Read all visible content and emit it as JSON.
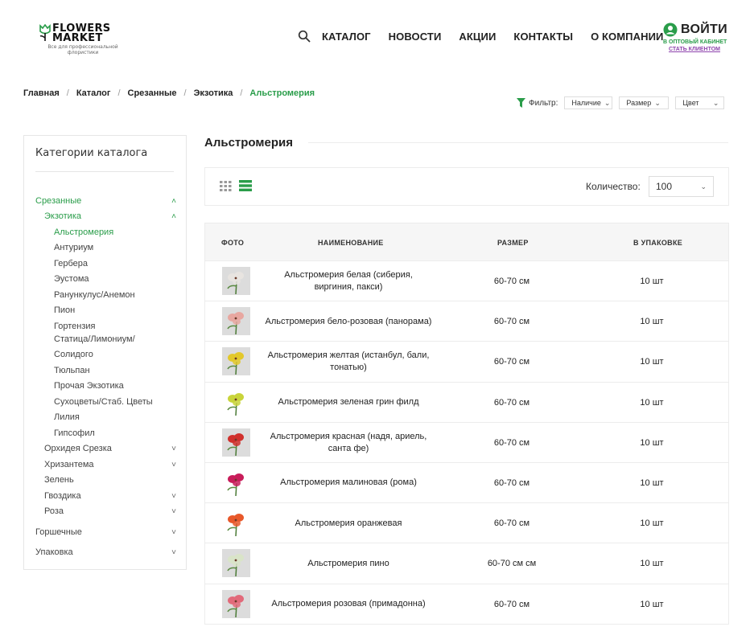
{
  "header": {
    "logo_title_1": "FLOWERS",
    "logo_title_2": "MARKET",
    "logo_subtitle": "Все для профессиональной флористики",
    "nav": [
      "КАТАЛОГ",
      "НОВОСТИ",
      "АКЦИИ",
      "КОНТАКТЫ",
      "О КОМПАНИИ"
    ],
    "login_label": "ВОЙТИ",
    "login_sub": "В ОПТОВЫЙ КАБИНЕТ",
    "register_label": "СТАТЬ КЛИЕНТОМ"
  },
  "breadcrumb": [
    "Главная",
    "Каталог",
    "Срезанные",
    "Экзотика",
    "Альстромерия"
  ],
  "filter": {
    "label": "Фильтр:",
    "selects": [
      "Наличие",
      "Размер",
      "Цвет"
    ]
  },
  "sidebar": {
    "title": "Категории каталога",
    "items": [
      {
        "label": "Срезанные",
        "level": 0,
        "state": "open"
      },
      {
        "label": "Экзотика",
        "level": 1,
        "state": "open"
      },
      {
        "label": "Альстромерия",
        "level": 2,
        "state": "active"
      },
      {
        "label": "Антуриум",
        "level": 2
      },
      {
        "label": "Гербера",
        "level": 2
      },
      {
        "label": "Эустома",
        "level": 2
      },
      {
        "label": "Ранункулус/Анемон",
        "level": 2
      },
      {
        "label": "Пион",
        "level": 2
      },
      {
        "label": "Гортензия",
        "level": 2
      },
      {
        "label": "Статица/Лимониум/",
        "level": 2
      },
      {
        "label": "Солидого",
        "level": 2
      },
      {
        "label": "Тюльпан",
        "level": 2
      },
      {
        "label": "Прочая Экзотика",
        "level": 2
      },
      {
        "label": "Сухоцветы/Стаб. Цветы",
        "level": 2
      },
      {
        "label": "Лилия",
        "level": 2
      },
      {
        "label": "Гипсофил",
        "level": 2
      },
      {
        "label": "Орхидея Срезка",
        "level": 1,
        "state": "closed"
      },
      {
        "label": "Хризантема",
        "level": 1,
        "state": "closed"
      },
      {
        "label": "Зелень",
        "level": 1
      },
      {
        "label": "Гвоздика",
        "level": 1,
        "state": "closed"
      },
      {
        "label": "Роза",
        "level": 1,
        "state": "closed"
      },
      {
        "label": "Горшечные",
        "level": 0,
        "state": "closed"
      },
      {
        "label": "Упаковка",
        "level": 0,
        "state": "closed"
      }
    ]
  },
  "main": {
    "title": "Альстромерия",
    "quantity_label": "Количество:",
    "quantity_value": "100"
  },
  "table": {
    "headers": [
      "ФОТО",
      "НАИМЕНОВАНИЕ",
      "РАЗМЕР",
      "В УПАКОВКЕ"
    ],
    "rows": [
      {
        "name": "Альстромерия белая (сиберия, виргиния, пакси)",
        "size": "60-70 см",
        "pack": "10 шт",
        "color": "#e8e4e0"
      },
      {
        "name": "Альстромерия бело-розовая (панорама)",
        "size": "60-70 см",
        "pack": "10 шт",
        "color": "#e8a7a0"
      },
      {
        "name": "Альстромерия желтая (истанбул, бали, тонатью)",
        "size": "60-70 см",
        "pack": "10 шт",
        "color": "#e3c82a"
      },
      {
        "name": "Альстромерия зеленая грин филд",
        "size": "60-70 см",
        "pack": "10 шт",
        "color": "#c9d43a"
      },
      {
        "name": "Альстромерия красная (надя, ариель, санта фе)",
        "size": "60-70 см",
        "pack": "10 шт",
        "color": "#d0302c"
      },
      {
        "name": "Альстромерия малиновая (рома)",
        "size": "60-70 см",
        "pack": "10 шт",
        "color": "#c81d5a"
      },
      {
        "name": "Альстромерия оранжевая",
        "size": "60-70 см",
        "pack": "10 шт",
        "color": "#e8582a"
      },
      {
        "name": "Альстромерия пино",
        "size": "60-70 см см",
        "pack": "10 шт",
        "color": "#d9e4c8"
      },
      {
        "name": "Альстромерия розовая (примадонна)",
        "size": "60-70 см",
        "pack": "10 шт",
        "color": "#e26a7a"
      }
    ]
  },
  "colors": {
    "accent_green": "#2a9d4a",
    "register_purple": "#8e44ad"
  }
}
